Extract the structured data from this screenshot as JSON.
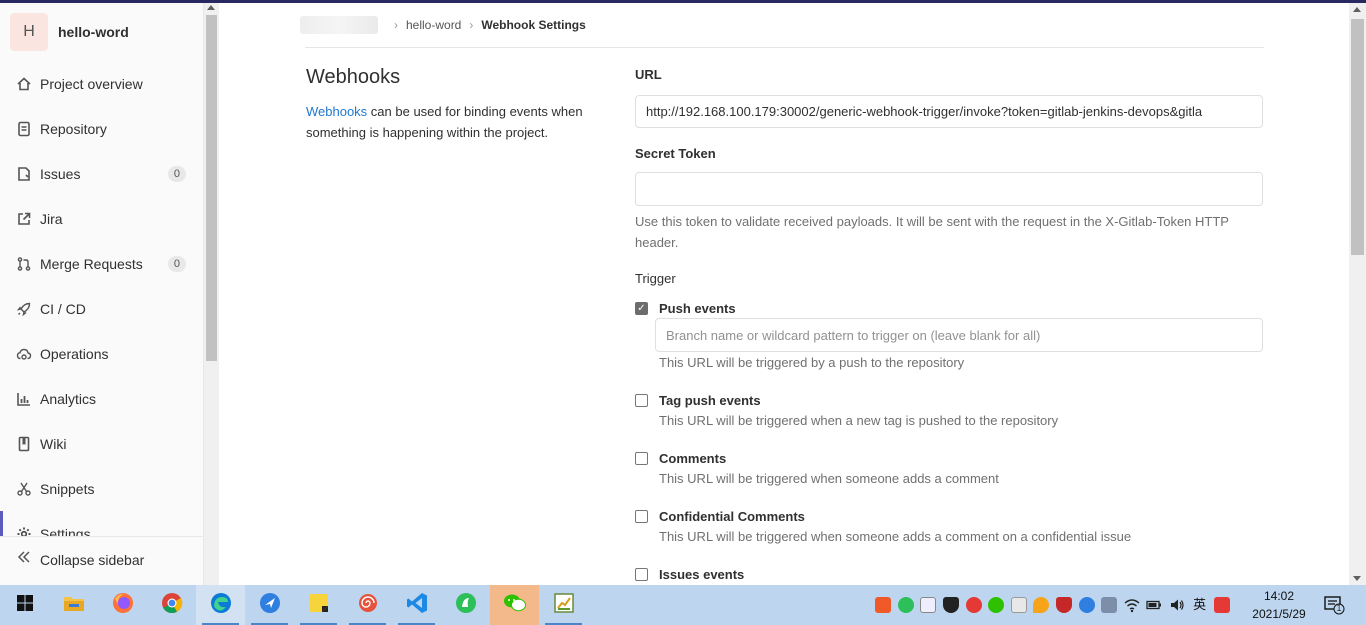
{
  "sidebar": {
    "project_initial": "H",
    "project_name": "hello-word",
    "items": [
      {
        "label": "Project overview",
        "icon": "home-icon"
      },
      {
        "label": "Repository",
        "icon": "document-icon"
      },
      {
        "label": "Issues",
        "icon": "issues-icon",
        "badge": "0"
      },
      {
        "label": "Jira",
        "icon": "external-link-icon"
      },
      {
        "label": "Merge Requests",
        "icon": "merge-request-icon",
        "badge": "0"
      },
      {
        "label": "CI / CD",
        "icon": "rocket-icon"
      },
      {
        "label": "Operations",
        "icon": "cloud-gear-icon"
      },
      {
        "label": "Analytics",
        "icon": "chart-icon"
      },
      {
        "label": "Wiki",
        "icon": "book-icon"
      },
      {
        "label": "Snippets",
        "icon": "scissors-icon"
      },
      {
        "label": "Settings",
        "icon": "gear-icon",
        "active": true
      }
    ],
    "collapse_label": "Collapse sidebar"
  },
  "breadcrumb": {
    "project": "hello-word",
    "current": "Webhook Settings"
  },
  "intro": {
    "title": "Webhooks",
    "link_text": "Webhooks",
    "description": " can be used for binding events when something is happening within the project."
  },
  "form": {
    "url_label": "URL",
    "url_value": "http://192.168.100.179:30002/generic-webhook-trigger/invoke?token=gitlab-jenkins-devops&gitla",
    "secret_label": "Secret Token",
    "secret_value": "",
    "secret_help": "Use this token to validate received payloads. It will be sent with the request in the X-Gitlab-Token HTTP header.",
    "trigger_label": "Trigger",
    "branch_placeholder": "Branch name or wildcard pattern to trigger on (leave blank for all)",
    "triggers": [
      {
        "label": "Push events",
        "checked": true,
        "help": "This URL will be triggered by a push to the repository"
      },
      {
        "label": "Tag push events",
        "checked": false,
        "help": "This URL will be triggered when a new tag is pushed to the repository"
      },
      {
        "label": "Comments",
        "checked": false,
        "help": "This URL will be triggered when someone adds a comment"
      },
      {
        "label": "Confidential Comments",
        "checked": false,
        "help": "This URL will be triggered when someone adds a comment on a confidential issue"
      },
      {
        "label": "Issues events",
        "checked": false,
        "help": ""
      }
    ]
  },
  "taskbar": {
    "apps": [
      "windows-start-icon",
      "file-explorer-icon",
      "firefox-icon",
      "chrome-icon",
      "edge-icon",
      "feishu-icon",
      "sticky-notes-icon",
      "app-spiral-icon",
      "vscode-icon",
      "green-app-icon",
      "wechat-icon",
      "chart-app-icon"
    ],
    "clock_time": "14:02",
    "clock_date": "2021/5/29",
    "notification_count": "1",
    "ime_label": "英"
  },
  "colors": {
    "accent_link": "#1f78d1",
    "top_bar": "#292961",
    "taskbar": "#bdd5ee"
  }
}
